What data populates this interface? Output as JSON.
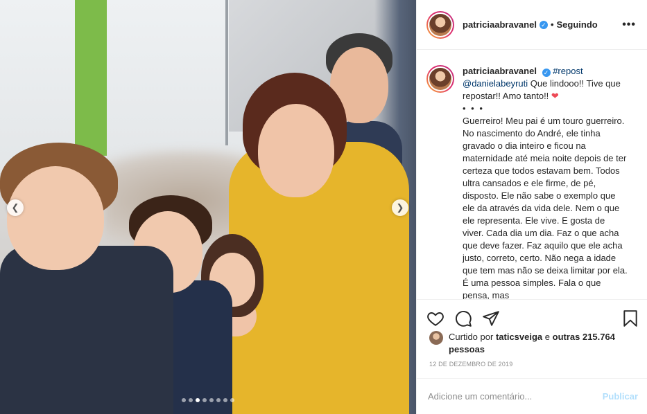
{
  "post": {
    "author": "patriciaabravanel",
    "follow_separator": "•",
    "follow_status": "Seguindo",
    "more_icon": "more-options-icon",
    "carousel": {
      "current_index": 3,
      "total": 8
    }
  },
  "caption": {
    "username": "patriciaabravanel",
    "hashtag": "#repost",
    "mention": "@danielabeyruti",
    "line1": "Que lindooo!! Tive que repostar!! Amo tanto!!",
    "heart": "❤",
    "dots": "• • •",
    "body": "Guerreiro! Meu pai é um touro guerreiro. No nascimento do André, ele tinha gravado o dia inteiro e ficou na maternidade até meia noite depois de ter certeza que todos estavam bem. Todos ultra cansados e ele firme, de pé, disposto. Ele não sabe o exemplo que ele da através da vida dele. Nem o que ele representa. Ele vive. E gosta de viver. Cada dia um dia. Faz o que acha que deve fazer. Faz aquilo que ele acha justo, correto, certo. Não nega a idade que tem mas não se deixa limitar por ela. É uma pessoa simples. Fala o que pensa, mas"
  },
  "likes": {
    "prefix": "Curtido por",
    "user": "taticsveiga",
    "connector": "e",
    "others": "outras 215.764 pessoas"
  },
  "date": "12 DE DEZEMBRO DE 2019",
  "comment_box": {
    "placeholder": "Adicione um comentário...",
    "submit_label": "Publicar"
  },
  "colors": {
    "verified": "#3897f0",
    "link": "#00376b",
    "heart": "#ed4956",
    "publish_disabled": "#b2dffc"
  }
}
